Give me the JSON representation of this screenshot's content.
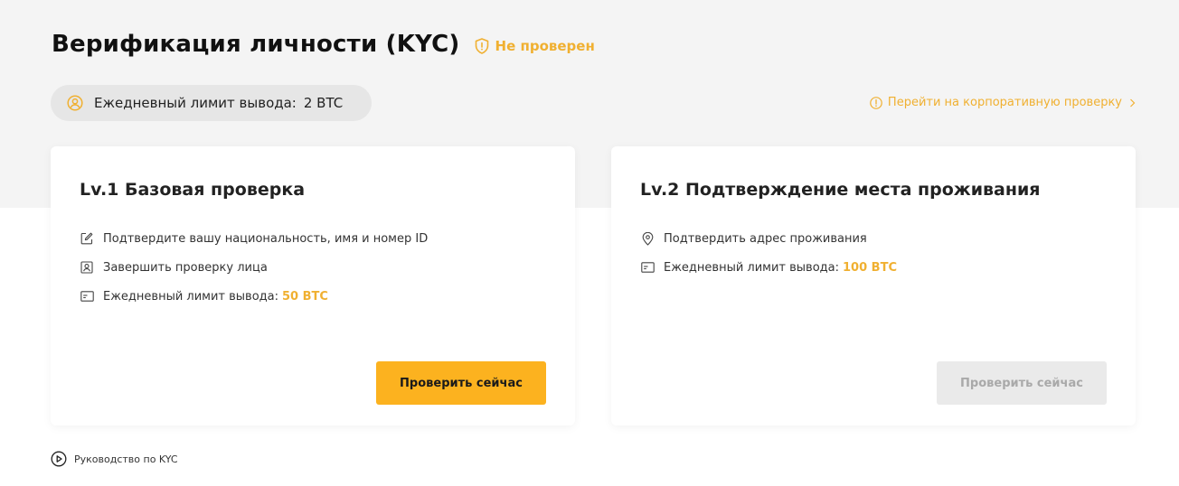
{
  "header": {
    "title": "Верификация личности (KYC)",
    "status": "Не проверен"
  },
  "limit_pill": {
    "label": "Ежедневный лимит вывода:",
    "value": "2 BTC"
  },
  "corporate_link": "Перейти на корпоративную проверку",
  "cards": [
    {
      "title": "Lv.1 Базовая проверка",
      "features": [
        {
          "icon": "edit-icon",
          "text": "Подтвердите вашу национальность, имя и номер ID",
          "highlight": ""
        },
        {
          "icon": "face-id-icon",
          "text": "Завершить проверку лица",
          "highlight": ""
        },
        {
          "icon": "id-card-icon",
          "text": "Ежедневный лимит вывода:",
          "highlight": "50 BTC"
        }
      ],
      "button": "Проверить сейчас",
      "button_enabled": true
    },
    {
      "title": "Lv.2 Подтверждение места проживания",
      "features": [
        {
          "icon": "location-pin-icon",
          "text": "Подтвердить адрес проживания",
          "highlight": ""
        },
        {
          "icon": "id-card-icon",
          "text": "Ежедневный лимит вывода:",
          "highlight": "100 BTC"
        }
      ],
      "button": "Проверить сейчас",
      "button_enabled": false
    }
  ],
  "guide_link": "Руководство по KYC",
  "colors": {
    "accent": "#f0b031",
    "button": "#fcb21f",
    "band": "#f4f4f4"
  }
}
